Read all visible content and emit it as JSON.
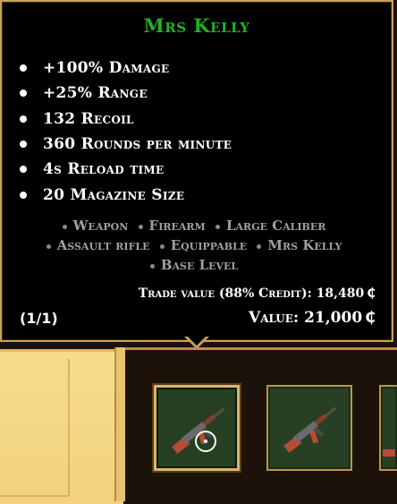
{
  "tooltip": {
    "title": "Mrs Kelly",
    "stats": [
      "+100% Damage",
      "+25% Range",
      "132 Recoil",
      "360 Rounds per minute",
      "4s Reload time",
      "20 Magazine Size"
    ],
    "tags_line1": [
      "Weapon",
      "Firearm",
      "Large Caliber"
    ],
    "tags_line2": [
      "Assault rifle",
      "Equippable",
      "Mrs Kelly"
    ],
    "tags_line3": [
      "Base Level"
    ],
    "trade_value": "Trade value (88% Credit): 18,480",
    "value": "Value: 21,000",
    "page_indicator": "(1/1)",
    "credit_symbol": "₵"
  },
  "inventory": {
    "slots": [
      {
        "item": "assault-rifle",
        "selected": true
      },
      {
        "item": "assault-rifle",
        "selected": false
      },
      {
        "item": "unknown",
        "selected": false
      }
    ]
  },
  "colors": {
    "title": "#1fb31f",
    "panel_border": "#c8a15a",
    "slot_bg": "#274024"
  }
}
